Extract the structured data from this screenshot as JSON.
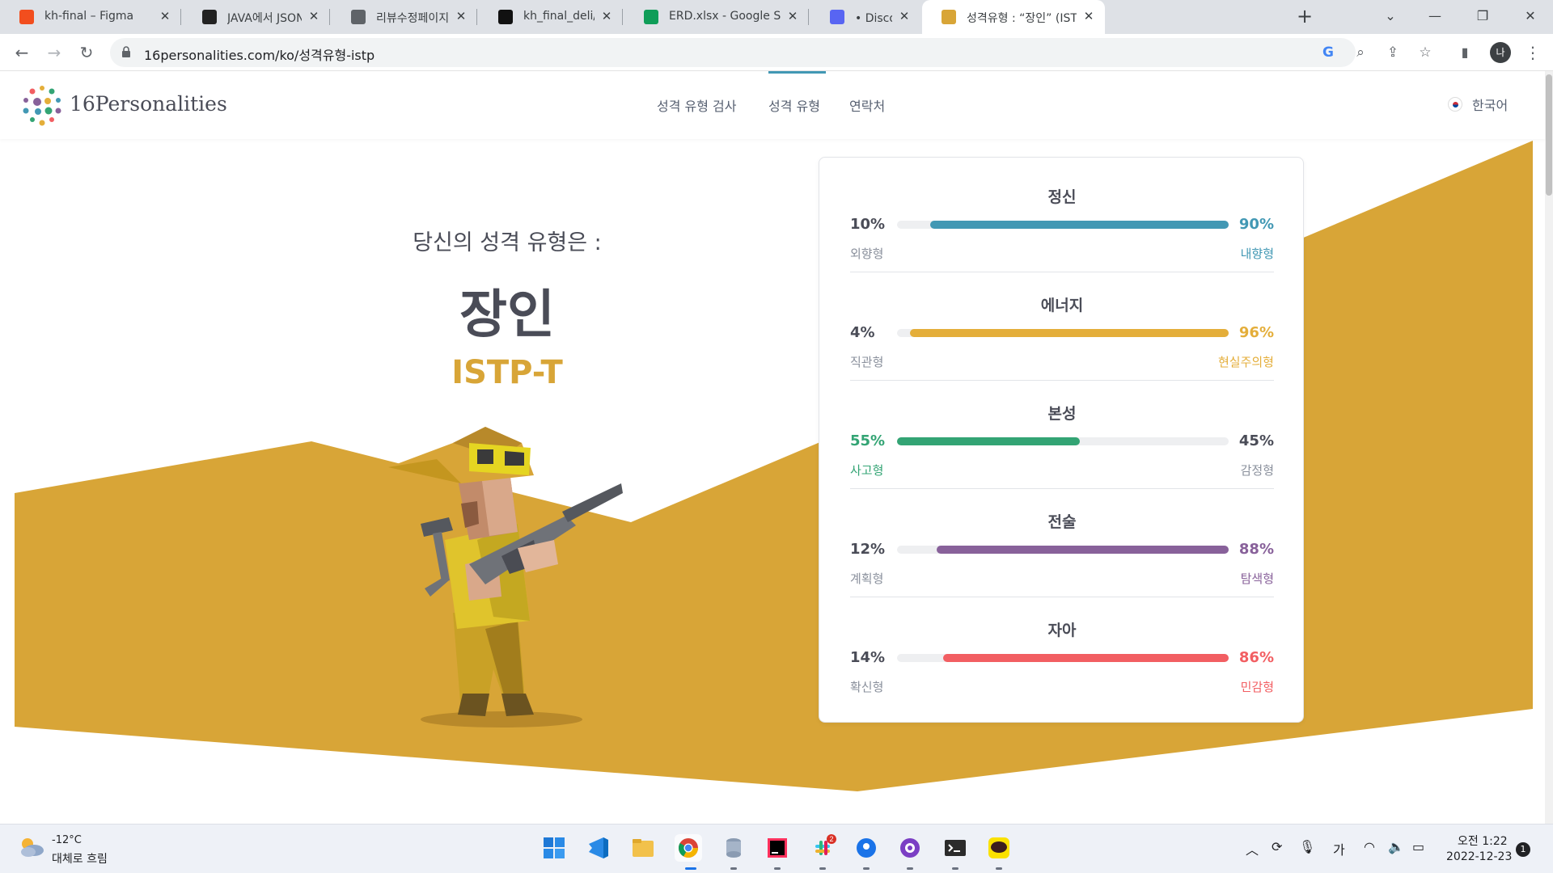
{
  "browser": {
    "tabs": [
      {
        "label": "kh-final – Figma",
        "color": "#f24e1e",
        "active": false
      },
      {
        "label": "JAVA에서 JSONParser",
        "color": "#222222",
        "active": false
      },
      {
        "label": "리뷰수정페이지",
        "color": "#5f6368",
        "active": false
      },
      {
        "label": "kh_final_deli/src/main",
        "color": "#111111",
        "active": false
      },
      {
        "label": "ERD.xlsx - Google Sh",
        "color": "#0f9d58",
        "active": false
      },
      {
        "label": "• Discord | @민",
        "color": "#5865f2",
        "active": false
      },
      {
        "label": "성격유형 : “장인” (IST",
        "color": "#d8a537",
        "active": true
      }
    ],
    "url": "16personalities.com/ko/성격유형-istp",
    "profile_initial": "나",
    "new_tab": "+",
    "minimize": "—",
    "restore": "❐",
    "close": "✕"
  },
  "site": {
    "logo": "16Personalities",
    "nav": [
      "성격 유형 검사",
      "성격 유형",
      "연락처"
    ],
    "active_nav": 1,
    "language": "한국어"
  },
  "result": {
    "intro": "당신의 성격 유형은 :",
    "type_name": "장인",
    "type_code": "ISTP-T"
  },
  "traits": [
    {
      "name": "정신",
      "left_pct": "10%",
      "right_pct": "90%",
      "left_label": "외향형",
      "right_label": "내향형",
      "dominant": "right",
      "value": 90,
      "color": "#4298b4"
    },
    {
      "name": "에너지",
      "left_pct": "4%",
      "right_pct": "96%",
      "left_label": "직관형",
      "right_label": "현실주의형",
      "dominant": "right",
      "value": 96,
      "color": "#e4ae3a"
    },
    {
      "name": "본성",
      "left_pct": "55%",
      "right_pct": "45%",
      "left_label": "사고형",
      "right_label": "감정형",
      "dominant": "left",
      "value": 55,
      "color": "#33a474"
    },
    {
      "name": "전술",
      "left_pct": "12%",
      "right_pct": "88%",
      "left_label": "계획형",
      "right_label": "탐색형",
      "dominant": "right",
      "value": 88,
      "color": "#88619a"
    },
    {
      "name": "자아",
      "left_pct": "14%",
      "right_pct": "86%",
      "left_label": "확신형",
      "right_label": "민감형",
      "dominant": "right",
      "value": 86,
      "color": "#f25e62"
    }
  ],
  "taskbar": {
    "temperature": "-12°C",
    "condition": "대체로 흐림",
    "time": "오전 1:22",
    "date": "2022-12-23",
    "notifications": "1",
    "ime": "가",
    "slack_badge": "2"
  }
}
